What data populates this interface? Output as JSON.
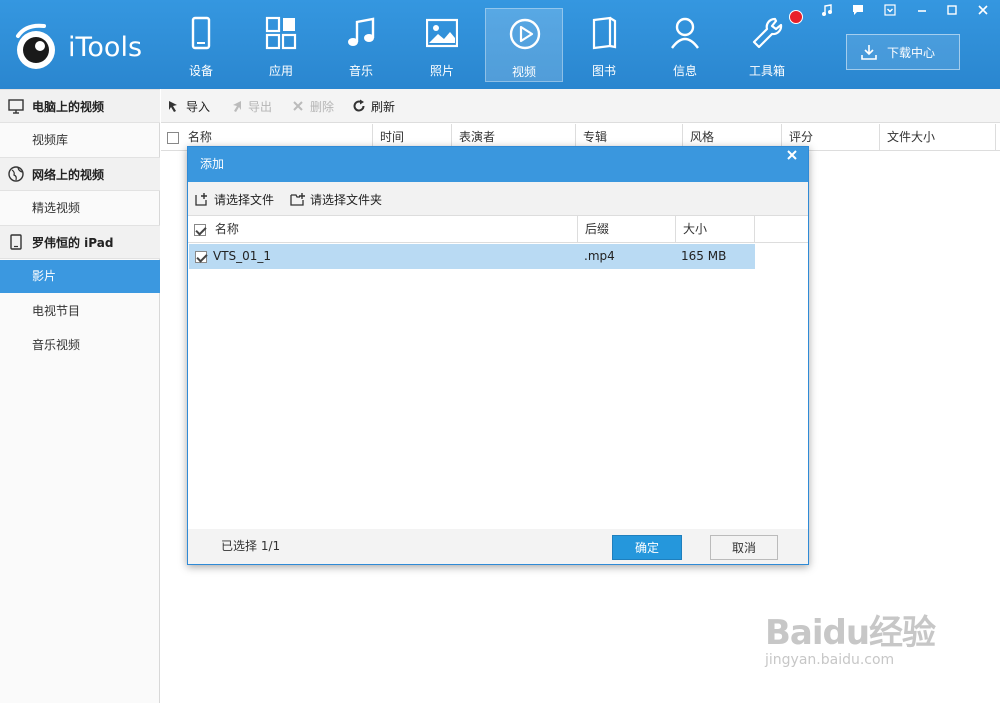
{
  "app": {
    "brand": "iTools",
    "accent_color": "#2f8fd9",
    "nav_tabs": [
      {
        "label": "设备",
        "icon": "device-icon"
      },
      {
        "label": "应用",
        "icon": "apps-grid-icon"
      },
      {
        "label": "音乐",
        "icon": "music-note-icon"
      },
      {
        "label": "照片",
        "icon": "photo-icon"
      },
      {
        "label": "视频",
        "icon": "play-circle-icon",
        "active": true
      },
      {
        "label": "图书",
        "icon": "book-icon"
      },
      {
        "label": "信息",
        "icon": "person-icon"
      },
      {
        "label": "工具箱",
        "icon": "wrench-icon"
      }
    ],
    "download_center": "下载中心"
  },
  "sidebar": {
    "sections": [
      {
        "header": "电脑上的视频",
        "icon": "monitor-icon",
        "items": [
          "视频库"
        ]
      },
      {
        "header": "网络上的视频",
        "icon": "globe-icon",
        "items": [
          "精选视频"
        ]
      },
      {
        "header": "罗伟恒的 iPad",
        "icon": "ipad-icon",
        "items": [
          "影片",
          "电视节目",
          "音乐视频"
        ]
      }
    ],
    "active_item": "影片"
  },
  "toolbar": {
    "import": "导入",
    "export": "导出",
    "delete": "删除",
    "refresh": "刷新"
  },
  "table": {
    "columns": [
      "名称",
      "时间",
      "表演者",
      "专辑",
      "风格",
      "评分",
      "文件大小"
    ]
  },
  "dialog": {
    "title": "添加",
    "select_file": "请选择文件",
    "select_folder": "请选择文件夹",
    "columns": [
      "名称",
      "后缀",
      "大小"
    ],
    "rows": [
      {
        "name": "VTS_01_1",
        "ext": ".mp4",
        "size": "165 MB",
        "checked": true
      }
    ],
    "selected_count": "已选择 1/1",
    "ok": "确定",
    "cancel": "取消"
  },
  "watermark": {
    "main": "Baidu经验",
    "sub": "jingyan.baidu.com"
  }
}
